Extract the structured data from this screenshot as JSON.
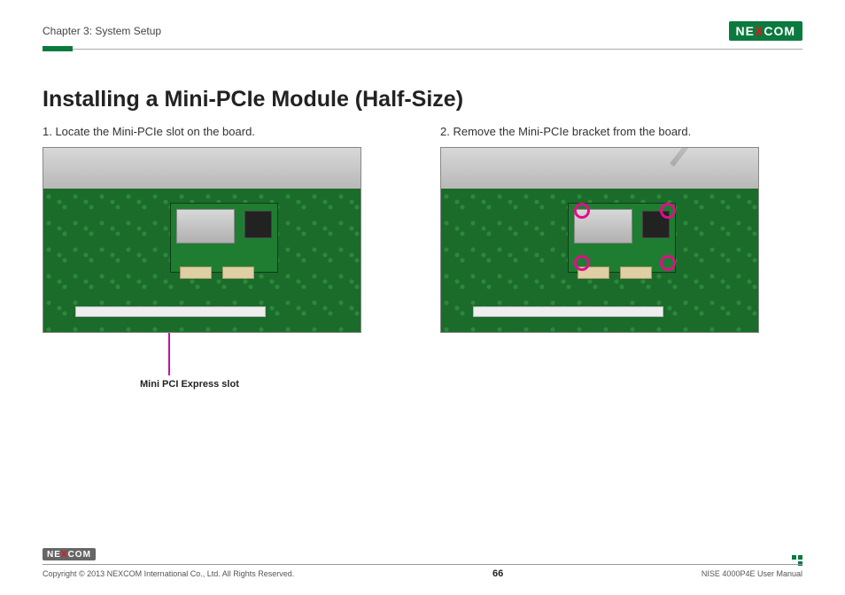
{
  "header": {
    "chapter": "Chapter 3: System Setup",
    "brand_pre": "NE",
    "brand_x": "X",
    "brand_post": "COM"
  },
  "title": "Installing a Mini-PCIe Module (Half-Size)",
  "steps": {
    "one": "1. Locate the Mini-PCIe slot on the board.",
    "two": "2. Remove the Mini-PCIe bracket from the board."
  },
  "caption": "Mini PCI Express slot",
  "footer": {
    "copyright": "Copyright © 2013 NEXCOM International Co., Ltd. All Rights Reserved.",
    "page": "66",
    "doc": "NISE 4000P4E User Manual"
  }
}
